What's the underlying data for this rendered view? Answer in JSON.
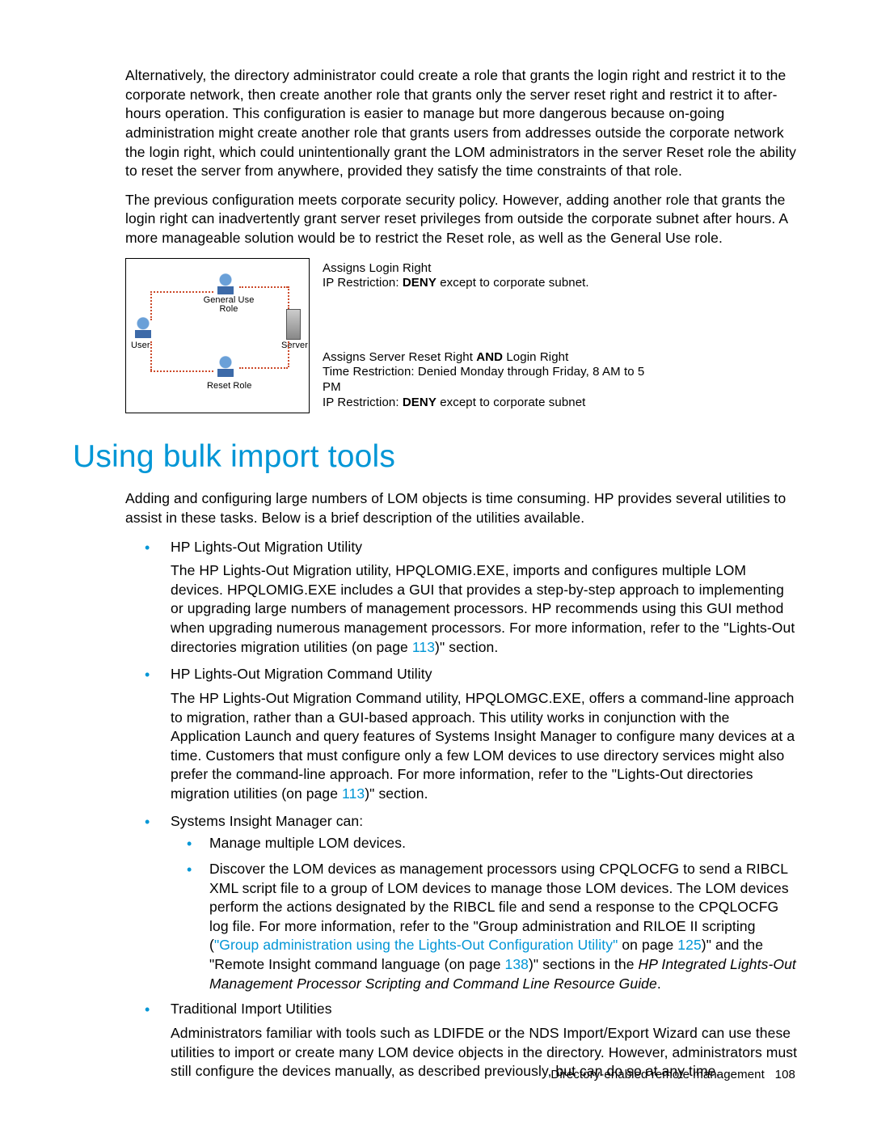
{
  "paragraphs": {
    "p1": "Alternatively, the directory administrator could create a role that grants the login right and restrict it to the corporate network, then create another role that grants only the server reset right and restrict it to after-hours operation. This configuration is easier to manage but more dangerous because on-going administration might create another role that grants users from addresses outside the corporate network the login right, which could unintentionally grant the LOM administrators in the server Reset role the ability to reset the server from anywhere, provided they satisfy the time constraints of that role.",
    "p2": "The previous configuration meets corporate security policy. However, adding another role that grants the login right can inadvertently grant server reset privileges from outside the corporate subnet after hours. A more manageable solution would be to restrict the Reset role, as well as the General Use role."
  },
  "diagram": {
    "user": "User",
    "general_use_role": "General Use Role",
    "reset_role": "Reset Role",
    "server": "Server",
    "top_line1": "Assigns Login Right",
    "top_line2a": "IP Restriction:  ",
    "top_deny": "DENY",
    "top_line2b": " except to corporate subnet.",
    "bot_line1a": "Assigns Server Reset Right ",
    "bot_and": "AND",
    "bot_line1b": " Login Right",
    "bot_line2": "Time Restriction:  Denied Monday through Friday, 8 AM to 5 PM",
    "bot_line3a": "IP Restriction:  ",
    "bot_line3b": " except to corporate subnet"
  },
  "heading": "Using bulk import tools",
  "intro": "Adding and configuring large numbers of LOM objects is time consuming. HP provides several utilities to assist in these tasks. Below is a brief description of the utilities available.",
  "items": {
    "i1_title": "HP Lights-Out Migration Utility",
    "i1_desc_a": "The HP Lights-Out Migration utility, HPQLOMIG.EXE, imports and configures multiple LOM devices. HPQLOMIG.EXE includes a GUI that provides a step-by-step approach to implementing or upgrading large numbers of management processors. HP recommends using this GUI method when upgrading numerous management processors. For more information, refer to the \"Lights-Out directories migration utilities (on page ",
    "i1_page": "113",
    "i1_desc_b": ")\" section.",
    "i2_title": "HP Lights-Out Migration Command Utility",
    "i2_desc_a": "The HP Lights-Out Migration Command utility, HPQLOMGC.EXE, offers a command-line approach to migration, rather than a GUI-based approach. This utility works in conjunction with the Application Launch and query features of Systems Insight Manager to configure many devices at a time. Customers that must configure only a few LOM devices to use directory services might also prefer the command-line approach. For more information, refer to the \"Lights-Out directories migration utilities (on page ",
    "i2_page": "113",
    "i2_desc_b": ")\" section.",
    "i3_title": "Systems Insight Manager can:",
    "i3_sub1": "Manage multiple LOM devices.",
    "i3_sub2_a": "Discover the LOM devices as management processors using CPQLOCFG to send a RIBCL XML script file to a group of LOM devices to manage those LOM devices. The LOM devices perform the actions designated by the RIBCL file and send a response to the CPQLOCFG log file. For more information, refer to the \"Group administration and RILOE II scripting (",
    "i3_sub2_link": "\"Group administration using the Lights-Out Configuration Utility\"",
    "i3_sub2_b": " on page ",
    "i3_sub2_page1": "125",
    "i3_sub2_c": ")\" and the \"Remote Insight command language (on page ",
    "i3_sub2_page2": "138",
    "i3_sub2_d": ")\" sections in the ",
    "i3_sub2_italic": "HP Integrated Lights-Out Management Processor Scripting and Command Line Resource Guide",
    "i3_sub2_e": ".",
    "i4_title": "Traditional Import Utilities",
    "i4_desc": "Administrators familiar with tools such as LDIFDE or the NDS Import/Export Wizard can use these utilities to import or create many LOM device objects in the directory. However, administrators must still configure the devices manually, as described previously, but can do so at any time."
  },
  "footer": {
    "section": "Directory-enabled remote management",
    "page": "108"
  }
}
